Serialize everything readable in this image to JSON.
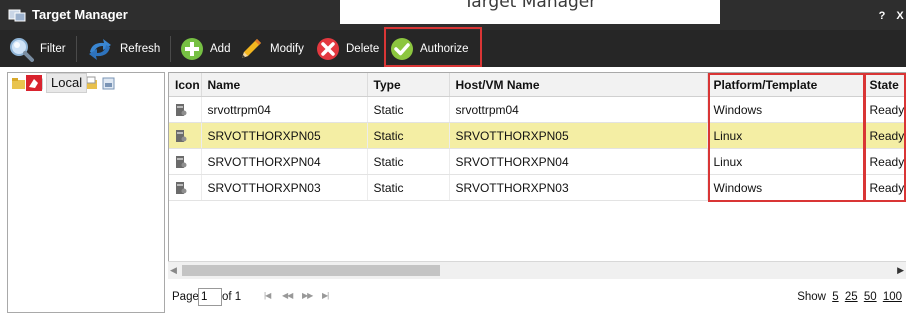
{
  "heading": "Target Manager",
  "window": {
    "title": "Target Manager",
    "help_label": "?",
    "close_label": "X"
  },
  "toolbar": {
    "filter_label": "Filter",
    "refresh_label": "Refresh",
    "add_label": "Add",
    "modify_label": "Modify",
    "delete_label": "Delete",
    "authorize_label": "Authorize"
  },
  "tree": {
    "root_label": "Local"
  },
  "grid": {
    "columns": [
      "Icon",
      "Name",
      "Type",
      "Host/VM Name",
      "Platform/Template",
      "State"
    ],
    "rows": [
      {
        "name": "srvottrpm04",
        "type": "Static",
        "host": "srvottrpm04",
        "platform": "Windows",
        "state": "Ready"
      },
      {
        "name": "SRVOTTHORXPN05",
        "type": "Static",
        "host": "SRVOTTHORXPN05",
        "platform": "Linux",
        "state": "Ready",
        "selected": true
      },
      {
        "name": "SRVOTTHORXPN04",
        "type": "Static",
        "host": "SRVOTTHORXPN04",
        "platform": "Linux",
        "state": "Ready"
      },
      {
        "name": "SRVOTTHORXPN03",
        "type": "Static",
        "host": "SRVOTTHORXPN03",
        "platform": "Windows",
        "state": "Ready"
      }
    ]
  },
  "pager": {
    "page_label": "Page",
    "page_value": "1",
    "of_label": "of 1",
    "show_label": "Show",
    "sizes": [
      "5",
      "25",
      "50",
      "100"
    ]
  },
  "colors": {
    "titlebar": "#2e2e2e",
    "toolbar": "#262626",
    "selected_row": "#f4eea4",
    "highlight": "#d93535"
  }
}
